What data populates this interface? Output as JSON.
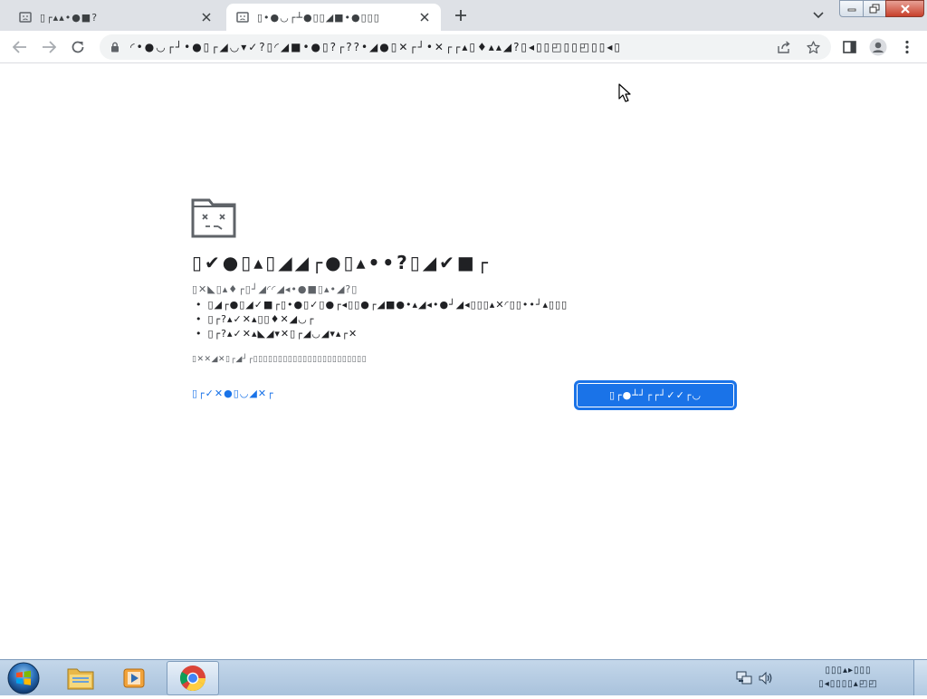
{
  "browser": {
    "tabs": [
      {
        "title": "▯┌▴▴•●■?",
        "favicon": "sad-page-icon",
        "active": false
      },
      {
        "title": "▯•●◡┌┴●▯▯◢■•●▯▯▯",
        "favicon": "sad-page-icon",
        "active": true
      }
    ],
    "new_tab_icon": "plus-icon",
    "tab_search_icon": "chevron-down-icon",
    "window_controls": [
      "minimize-icon",
      "restore-icon",
      "close-icon"
    ],
    "toolbar_icons": [
      "back-arrow-icon",
      "forward-arrow-icon",
      "reload-icon",
      "share-icon",
      "star-icon",
      "side-panel-icon",
      "profile-icon",
      "menu-dots-icon"
    ],
    "omnibox": {
      "lock_icon": "lock-icon",
      "url": "◜•●◡┌┘•●▯┌◢◡▾✓?▯◜◢■•●▯?┌??•◢●▯✕┌┘•✕┌┌▴▯♦▴▴◢?▯◂▯▯◰▯▯◰▯▯◂▯"
    }
  },
  "error_page": {
    "icon": "sad-folder-icon",
    "heading": "▯✔●▯▴▯◢◢┌●▯▴••?▯◢✔■┌",
    "subtext": "▯✕◣▯▴♦┌▯┘◢◜◜◢◂•●■▯▴•◢?▯",
    "suggestions": [
      "▯◢┌●▯◢✓■┌▯•●▯✓▯●┌◂▯▯●┌◢■●•▴◢◂•●┘◢◂▯▯▯▴✕◜▯▯••┘▴▯▯▯",
      "▯┌?▴✓✕▴▯▯♦✕◢◡┌",
      "▯┌?▴✓✕▴◣◢▾✕▯┌◢◡◢▾▴┌✕"
    ],
    "error_code": "▯✕✕◢✕▯┌◢┘┌▯▯▯▯▯▯▯▯▯▯▯▯▯▯▯▯▯▯▯▯▯▯▯",
    "details_link": "▯┌✓✕●▯◡◢✕┌",
    "reload_button": "▯┌●┴┘┌┌┘✓✓┌◡",
    "accent_color": "#1a73e8"
  },
  "taskbar": {
    "pinned": [
      "start-orb-icon",
      "windows-explorer-icon",
      "media-player-icon",
      "chrome-icon"
    ],
    "active_app": "chrome-icon",
    "tray_icons": [
      "network-icon",
      "volume-icon"
    ],
    "clock": {
      "time": "▯▯▯▴▸▯▯▯",
      "date": "▯◂▯▯▯▯▴◰◰"
    }
  }
}
